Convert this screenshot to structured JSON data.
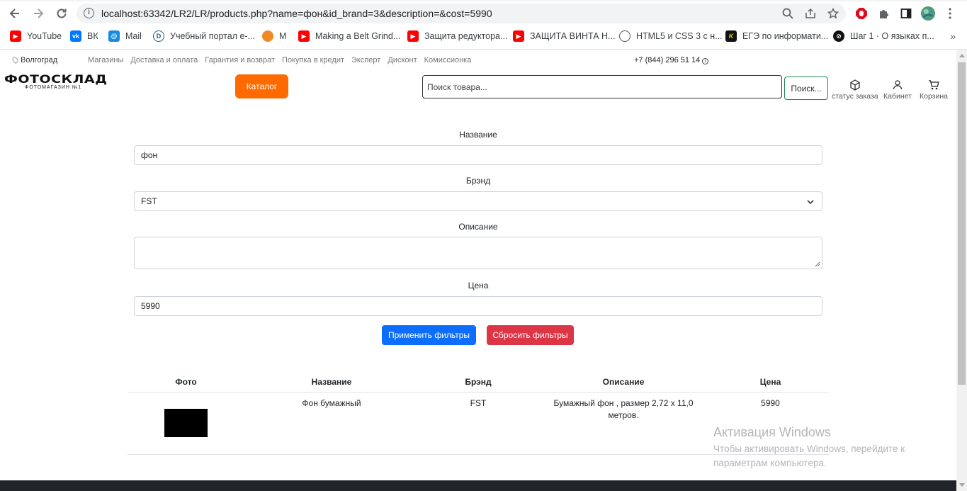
{
  "browser": {
    "url": "localhost:63342/LR2/LR/products.php?name=фон&id_brand=3&description=&cost=5990",
    "bookmarks": [
      {
        "label": "YouTube",
        "icon": "youtube-icon"
      },
      {
        "label": "ВК",
        "icon": "vk-icon"
      },
      {
        "label": "Mail",
        "icon": "mail-icon"
      },
      {
        "label": "Учебный портал е-...",
        "icon": "portal-icon"
      },
      {
        "label": "M",
        "icon": "m-icon"
      },
      {
        "label": "Making a Belt Grind...",
        "icon": "youtube-icon"
      },
      {
        "label": "Защита редуктора...",
        "icon": "youtube-icon"
      },
      {
        "label": "ЗАЩИТА ВИНТА Н...",
        "icon": "youtube-icon"
      },
      {
        "label": "HTML5 и CSS 3 с н...",
        "icon": "globe-icon"
      },
      {
        "label": "ЕГЭ по информати...",
        "icon": "k-icon"
      },
      {
        "label": "Шаг 1 · О языках п...",
        "icon": "stepik-icon"
      }
    ],
    "more_label": "»"
  },
  "site": {
    "city": "Волгоград",
    "top_links": [
      "Магазины",
      "Доставка и оплата",
      "Гарантия и возврат",
      "Покупка в кредит",
      "Эксперт",
      "Дисконт",
      "Комиссионка"
    ],
    "phone": "+7 (844) 296 51 14",
    "phone_info": "i",
    "logo_word": "ФОТОСКЛАД",
    "logo_sub": "ФОТОМАГАЗИН №1",
    "catalog_label": "Каталог",
    "search_placeholder": "Поиск товара...",
    "search_button": "Поиск...",
    "actions": {
      "order_status": "статус заказа",
      "cabinet": "Кабинет",
      "cart": "Корзина"
    }
  },
  "filter_form": {
    "name_label": "Название",
    "name_value": "фон",
    "brand_label": "Брэнд",
    "brand_value": "FST",
    "description_label": "Описание",
    "description_value": "",
    "price_label": "Цена",
    "price_value": "5990",
    "apply_label": "Применить фильтры",
    "reset_label": "Сбросить фильтры"
  },
  "table": {
    "headers": [
      "Фото",
      "Название",
      "Брэнд",
      "Описание",
      "Цена"
    ],
    "rows": [
      {
        "name": "Фон бумажный",
        "brand": "FST",
        "description": "Бумажный фон , размер 2,72 х 11,0 метров.",
        "price": "5990"
      }
    ]
  },
  "watermark": {
    "title": "Активация Windows",
    "subtitle": "Чтобы активировать Windows, перейдите к параметрам компьютера."
  },
  "colors": {
    "primary": "#0d6efd",
    "danger": "#dc3545",
    "catalog_orange": "#ff6a00",
    "search_border": "#198754"
  }
}
